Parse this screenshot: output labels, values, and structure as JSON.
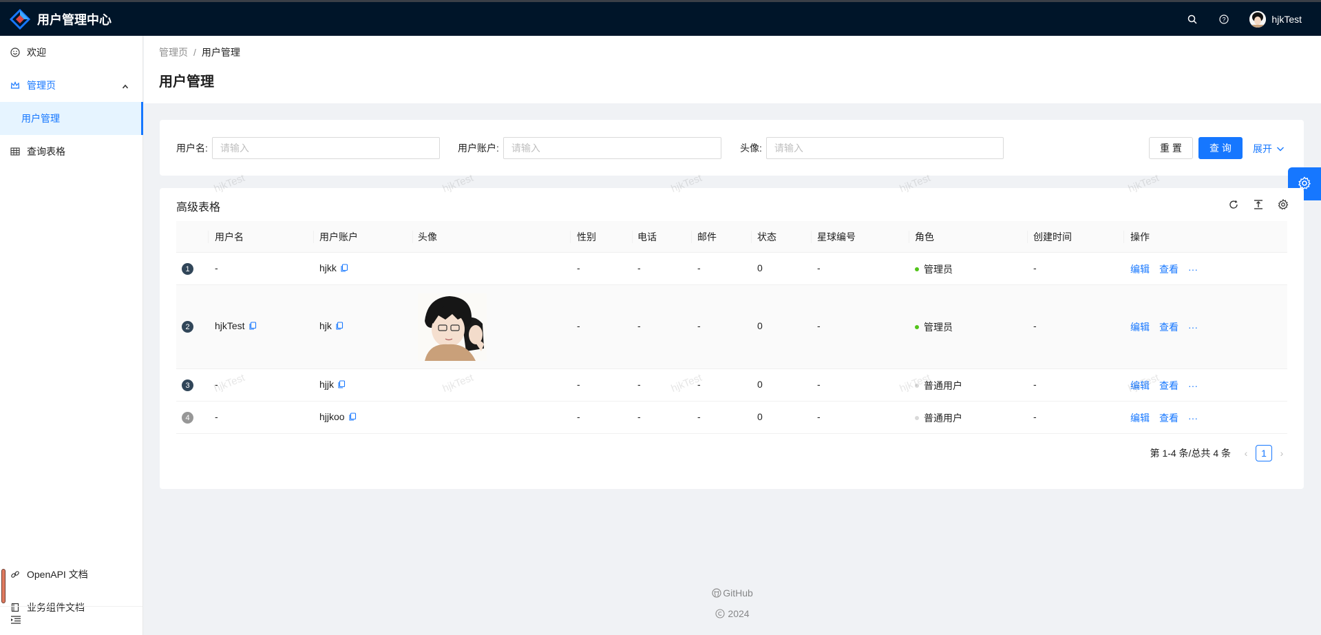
{
  "app": {
    "title": "用户管理中心",
    "user": "hjkTest"
  },
  "sidebar": {
    "items": [
      {
        "label": "欢迎",
        "icon": "smile-icon"
      },
      {
        "label": "管理页",
        "icon": "crown-icon"
      },
      {
        "label": "用户管理"
      },
      {
        "label": "查询表格",
        "icon": "table-icon"
      }
    ],
    "bottom": [
      {
        "label": "OpenAPI 文档",
        "icon": "link-icon"
      },
      {
        "label": "业务组件文档",
        "icon": "book-icon"
      }
    ]
  },
  "breadcrumb": {
    "root": "管理页",
    "sep": "/",
    "current": "用户管理"
  },
  "page_title": "用户管理",
  "search": {
    "username_label": "用户名:",
    "account_label": "用户账户:",
    "avatar_label": "头像:",
    "placeholder": "请输入",
    "reset": "重 置",
    "query": "查 询",
    "expand": "展开"
  },
  "table": {
    "title": "高级表格",
    "columns": [
      "用户名",
      "用户账户",
      "头像",
      "性别",
      "电话",
      "邮件",
      "状态",
      "星球编号",
      "角色",
      "创建时间",
      "操作"
    ],
    "rows": [
      {
        "index": "1",
        "username": "-",
        "account": "hjkk",
        "gender": "-",
        "phone": "-",
        "email": "-",
        "status": "0",
        "planet": "-",
        "role": "管理员",
        "role_color": "#52c41a",
        "created": "-"
      },
      {
        "index": "2",
        "username": "hjkTest",
        "account": "hjk",
        "gender": "-",
        "phone": "-",
        "email": "-",
        "status": "0",
        "planet": "-",
        "role": "管理员",
        "role_color": "#52c41a",
        "created": "-"
      },
      {
        "index": "3",
        "username": "-",
        "account": "hjjk",
        "gender": "-",
        "phone": "-",
        "email": "-",
        "status": "0",
        "planet": "-",
        "role": "普通用户",
        "role_color": "#d9d9d9",
        "created": "-"
      },
      {
        "index": "4",
        "username": "-",
        "account": "hjjkoo",
        "gender": "-",
        "phone": "-",
        "email": "-",
        "status": "0",
        "planet": "-",
        "role": "普通用户",
        "role_color": "#d9d9d9",
        "created": "-"
      }
    ],
    "actions": {
      "edit": "编辑",
      "view": "查看",
      "more": "···"
    }
  },
  "pagination": {
    "summary": "第 1-4 条/总共 4 条",
    "current": "1"
  },
  "watermark": "hjkTest",
  "footer": {
    "github": "GitHub",
    "copyright": "2024"
  }
}
